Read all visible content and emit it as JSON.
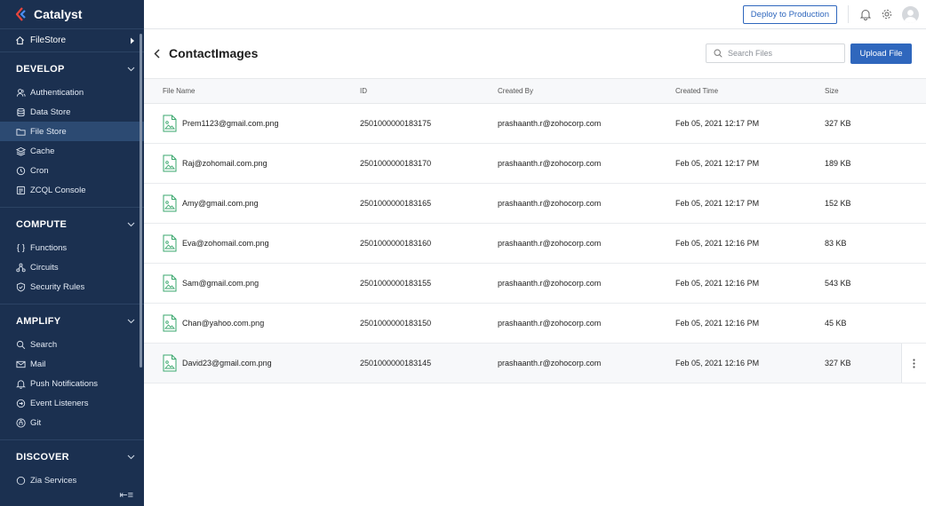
{
  "app": {
    "name": "Catalyst"
  },
  "selector": {
    "label": "FileStore"
  },
  "sections": [
    {
      "title": "DEVELOP",
      "items": [
        "Authentication",
        "Data Store",
        "File Store",
        "Cache",
        "Cron",
        "ZCQL Console"
      ]
    },
    {
      "title": "COMPUTE",
      "items": [
        "Functions",
        "Circuits",
        "Security Rules"
      ]
    },
    {
      "title": "AMPLIFY",
      "items": [
        "Search",
        "Mail",
        "Push Notifications",
        "Event Listeners",
        "Git"
      ]
    },
    {
      "title": "DISCOVER",
      "items": [
        "Zia Services"
      ]
    }
  ],
  "active_item": "File Store",
  "topbar": {
    "deploy_label": "Deploy to Production"
  },
  "page": {
    "title": "ContactImages",
    "search_placeholder": "Search Files",
    "upload_label": "Upload File"
  },
  "table": {
    "columns": [
      "File Name",
      "ID",
      "Created By",
      "Created Time",
      "Size"
    ],
    "rows": [
      {
        "name": "Prem1123@gmail.com.png",
        "id": "2501000000183175",
        "by": "prashaanth.r@zohocorp.com",
        "time": "Feb 05, 2021 12:17 PM",
        "size": "327 KB"
      },
      {
        "name": "Raj@zohomail.com.png",
        "id": "2501000000183170",
        "by": "prashaanth.r@zohocorp.com",
        "time": "Feb 05, 2021 12:17 PM",
        "size": "189 KB"
      },
      {
        "name": "Amy@gmail.com.png",
        "id": "2501000000183165",
        "by": "prashaanth.r@zohocorp.com",
        "time": "Feb 05, 2021 12:17 PM",
        "size": "152 KB"
      },
      {
        "name": "Eva@zohomail.com.png",
        "id": "2501000000183160",
        "by": "prashaanth.r@zohocorp.com",
        "time": "Feb 05, 2021 12:16 PM",
        "size": "83 KB"
      },
      {
        "name": "Sam@gmail.com.png",
        "id": "2501000000183155",
        "by": "prashaanth.r@zohocorp.com",
        "time": "Feb 05, 2021 12:16 PM",
        "size": "543 KB"
      },
      {
        "name": "Chan@yahoo.com.png",
        "id": "2501000000183150",
        "by": "prashaanth.r@zohocorp.com",
        "time": "Feb 05, 2021 12:16 PM",
        "size": "45 KB"
      },
      {
        "name": "David23@gmail.com.png",
        "id": "2501000000183145",
        "by": "prashaanth.r@zohocorp.com",
        "time": "Feb 05, 2021 12:16 PM",
        "size": "327 KB"
      }
    ],
    "hovered_row": 6
  },
  "colors": {
    "sidebar": "#1b3050",
    "accent": "#2f67bd",
    "file_icon": "#3aa76d"
  },
  "icons": {
    "Authentication": "users-icon",
    "Data Store": "database-icon",
    "File Store": "folder-icon",
    "Cache": "layers-icon",
    "Cron": "clock-icon",
    "ZCQL Console": "console-icon",
    "Functions": "braces-icon",
    "Circuits": "circuit-icon",
    "Security Rules": "shield-icon",
    "Search": "search-icon",
    "Mail": "mail-icon",
    "Push Notifications": "bell-icon",
    "Event Listeners": "event-icon",
    "Git": "git-icon",
    "Zia Services": "zia-icon"
  }
}
